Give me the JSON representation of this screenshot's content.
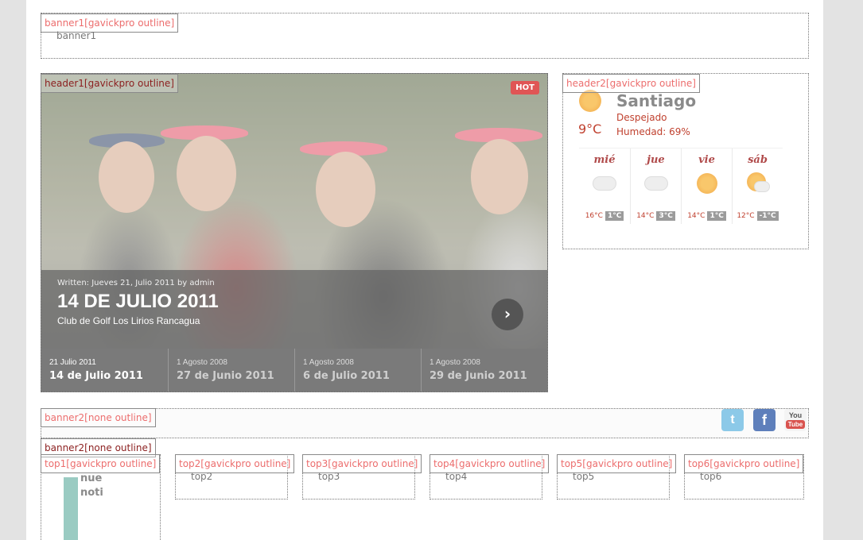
{
  "banner1": {
    "tag": "banner1[gavickpro outline]",
    "content": "banner1"
  },
  "header1": {
    "tag": "header1[gavickpro outline]",
    "badge": "HOT",
    "written": "Written: Jueves 21, Julio 2011 by admin",
    "title": "14 DE JULIO 2011",
    "subtitle": "Club de Golf Los Lirios Rancagua",
    "next_icon": "chevron-right-icon",
    "slides": [
      {
        "date": "21 Julio 2011",
        "title": "14 de Julio 2011",
        "active": true
      },
      {
        "date": "1 Agosto 2008",
        "title": "27 de Junio 2011",
        "active": false
      },
      {
        "date": "1 Agosto 2008",
        "title": "6 de Julio 2011",
        "active": false
      },
      {
        "date": "1 Agosto 2008",
        "title": "29 de Junio 2011",
        "active": false
      }
    ]
  },
  "header2": {
    "tag": "header2[gavickpro outline]",
    "city": "Santiago",
    "temp": "9°C",
    "condition": "Despejado",
    "humidity": "Humedad: 69%",
    "forecast": [
      {
        "day": "mié",
        "icon": "cloud-icon",
        "high": "16°C",
        "low": "1°C"
      },
      {
        "day": "jue",
        "icon": "cloud-icon",
        "high": "14°C",
        "low": "3°C"
      },
      {
        "day": "vie",
        "icon": "sun-icon",
        "high": "14°C",
        "low": "1°C"
      },
      {
        "day": "sáb",
        "icon": "sun-cloud-icon",
        "high": "12°C",
        "low": "-1°C"
      }
    ]
  },
  "banner2": {
    "tag": "banner2[none outline]",
    "tag2": "banner2[none outline]"
  },
  "social": {
    "twitter": "t",
    "facebook": "f",
    "youtube_top": "You",
    "youtube_bottom": "Tube"
  },
  "top": [
    {
      "tag": "top1[gavickpro outline]",
      "lines": [
        "nue",
        "noti"
      ]
    },
    {
      "tag": "top2[gavickpro outline]",
      "content": "top2"
    },
    {
      "tag": "top3[gavickpro outline]",
      "content": "top3"
    },
    {
      "tag": "top4[gavickpro outline]",
      "content": "top4"
    },
    {
      "tag": "top5[gavickpro outline]",
      "content": "top5"
    },
    {
      "tag": "top6[gavickpro outline]",
      "content": "top6"
    }
  ]
}
